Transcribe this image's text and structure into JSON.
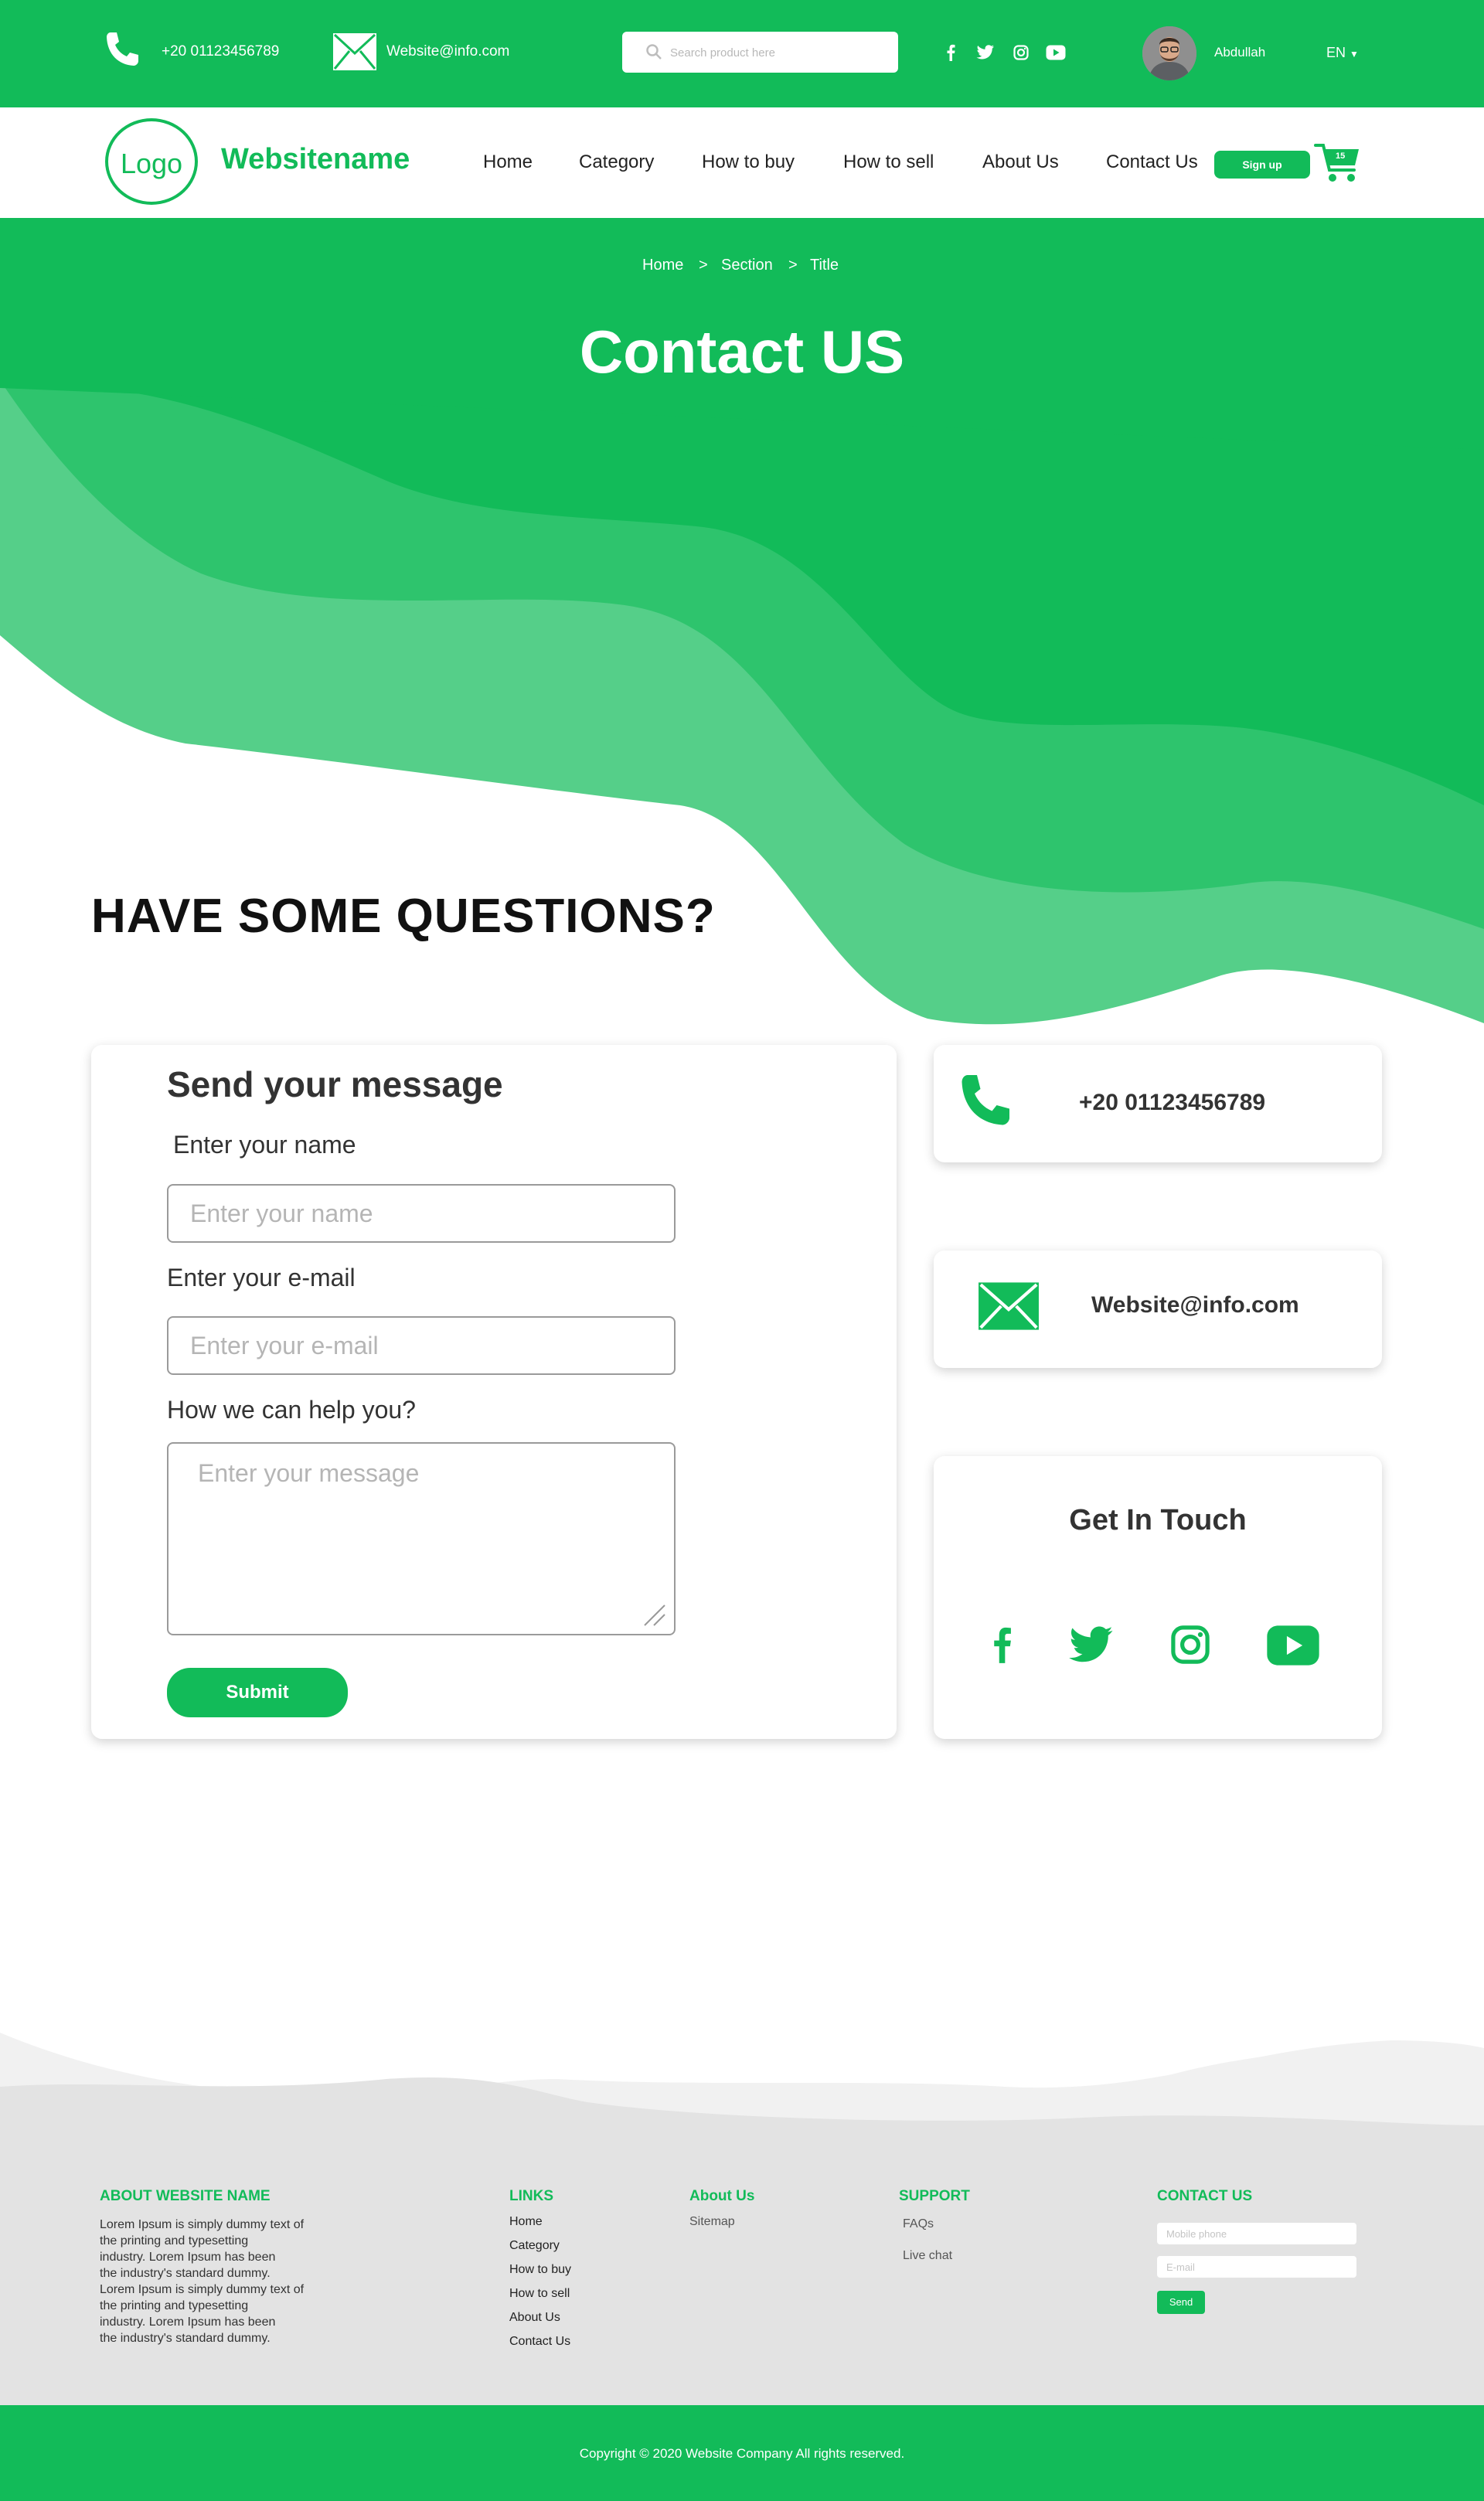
{
  "colors": {
    "brand": "#12bb59",
    "brand_light": "#2ec46d",
    "brand_lighter": "#55cf89",
    "footer_bg": "#e3e3e3"
  },
  "topbar": {
    "phone": "+20 01123456789",
    "email": "Website@info.com",
    "search_placeholder": "Search product here",
    "social_icons": [
      "facebook-icon",
      "twitter-icon",
      "instagram-icon",
      "youtube-icon"
    ],
    "user_name": "Abdullah",
    "language": "EN"
  },
  "nav": {
    "logo": "Logo",
    "site_name": "Websitename",
    "links": [
      "Home",
      "Category",
      "How to buy",
      "How to sell",
      "About Us",
      "Contact Us"
    ],
    "signup": "Sign up",
    "cart_count": "15"
  },
  "hero": {
    "breadcrumb": [
      "Home",
      "Section",
      "Title"
    ],
    "separator": ">",
    "title": "Contact US"
  },
  "main": {
    "heading": "HAVE SOME QUESTIONS?",
    "form": {
      "title": "Send your message",
      "name_label": "Enter your name",
      "name_placeholder": "Enter your name",
      "email_label": "Enter your e-mail",
      "email_placeholder": "Enter your e-mail",
      "message_label": "How we can help you?",
      "message_placeholder": "Enter your message",
      "submit": "Submit"
    },
    "contact": {
      "phone": "+20 01123456789",
      "email": "Website@info.com",
      "get_in_touch": "Get In Touch"
    }
  },
  "footer": {
    "about_title": "ABOUT WEBSITE NAME",
    "about_lines": [
      "Lorem Ipsum is simply dummy text of",
      "the printing and typesetting",
      "industry. Lorem Ipsum has been",
      "the industry's standard dummy.",
      "Lorem Ipsum is simply dummy text of",
      "the printing and typesetting",
      "industry. Lorem Ipsum has been",
      "the industry's standard dummy."
    ],
    "links_title": "LINKS",
    "links": [
      "Home",
      "Category",
      "How to buy",
      "How to sell",
      "About Us",
      "Contact Us"
    ],
    "aboutus_title": "About Us",
    "aboutus_links": [
      "Sitemap"
    ],
    "support_title": "SUPPORT",
    "support_links": [
      "FAQs",
      "Live chat"
    ],
    "contact_title": "CONTACT US",
    "mobile_placeholder": "Mobile phone",
    "email_placeholder": "E-mail",
    "send": "Send",
    "copyright": "Copyright © 2020 Website Company All rights reserved."
  }
}
